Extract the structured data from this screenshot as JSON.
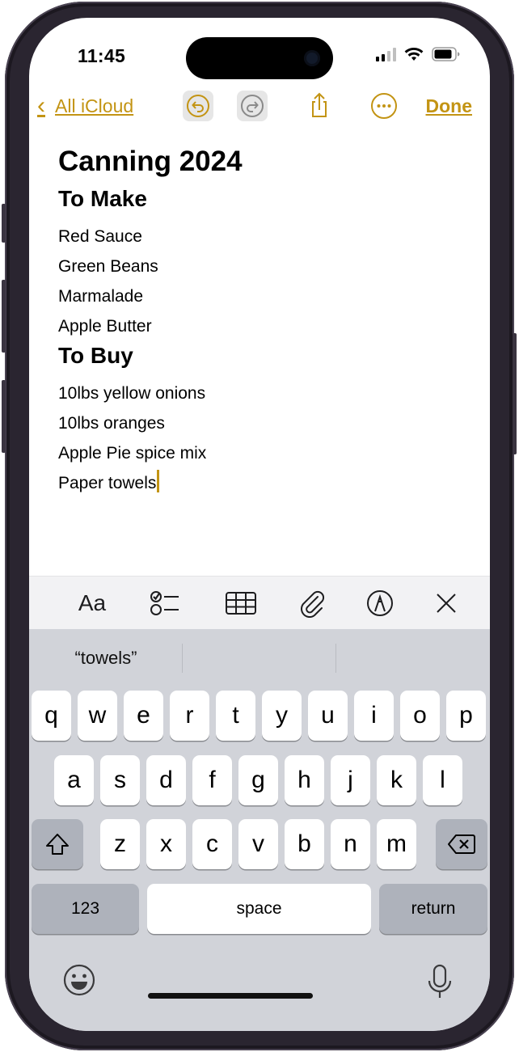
{
  "status": {
    "time": "11:45"
  },
  "toolbar": {
    "back_label": "All iCloud",
    "done_label": "Done"
  },
  "note": {
    "title": "Canning 2024",
    "sections": [
      {
        "heading": "To Make",
        "items": [
          "Red Sauce",
          "Green Beans",
          "Marmalade",
          "Apple Butter"
        ]
      },
      {
        "heading": "To Buy",
        "items": [
          "10lbs yellow onions",
          "10lbs oranges",
          "Apple Pie spice mix",
          "Paper towels"
        ]
      }
    ]
  },
  "format_bar": {
    "text_style_label": "Aa",
    "icons": [
      "text-style-icon",
      "checklist-icon",
      "table-icon",
      "paperclip-icon",
      "markup-pen-icon",
      "close-icon"
    ]
  },
  "keyboard": {
    "prediction": "“towels”",
    "row1": [
      "q",
      "w",
      "e",
      "r",
      "t",
      "y",
      "u",
      "i",
      "o",
      "p"
    ],
    "row2": [
      "a",
      "s",
      "d",
      "f",
      "g",
      "h",
      "j",
      "k",
      "l"
    ],
    "row3": [
      "z",
      "x",
      "c",
      "v",
      "b",
      "n",
      "m"
    ],
    "numbers_label": "123",
    "space_label": "space",
    "return_label": "return",
    "icons": [
      "shift-icon",
      "delete-icon",
      "emoji-icon",
      "microphone-icon"
    ]
  },
  "colors": {
    "accent": "#c39414",
    "keyboard_bg": "#d1d3d9",
    "key_bg": "#ffffff",
    "special_key_bg": "#aeb2bb"
  }
}
